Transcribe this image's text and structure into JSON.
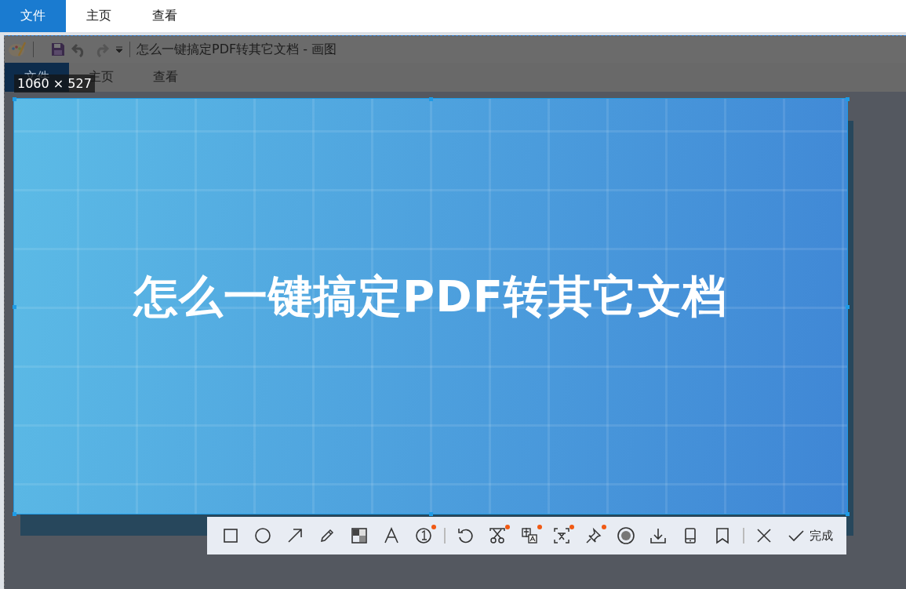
{
  "app_tabs": [
    {
      "label": "文件",
      "selected": true
    },
    {
      "label": "主页",
      "selected": false
    },
    {
      "label": "查看",
      "selected": false
    }
  ],
  "paint_window": {
    "title": "怎么一键搞定PDF转其它文档 - 画图",
    "ribbon_tabs": [
      {
        "label": "文件",
        "selected": true
      },
      {
        "label": "主页",
        "selected": false
      },
      {
        "label": "查看",
        "selected": false
      }
    ],
    "canvas_image": {
      "banner_title": "怎么一键搞定PDF转其它文档"
    }
  },
  "capture": {
    "size_label": "1060 × 527",
    "tool_groups": [
      [
        {
          "kind": "rectangle",
          "badge": false
        },
        {
          "kind": "ellipse",
          "badge": false
        },
        {
          "kind": "arrow",
          "badge": false
        },
        {
          "kind": "pencil",
          "badge": false
        },
        {
          "kind": "mosaic",
          "badge": false
        },
        {
          "kind": "text",
          "badge": false
        },
        {
          "kind": "number",
          "badge": true
        }
      ],
      [
        {
          "kind": "undo",
          "badge": false
        },
        {
          "kind": "scissors",
          "badge": true
        },
        {
          "kind": "translate",
          "badge": true
        },
        {
          "kind": "ocr",
          "badge": true
        },
        {
          "kind": "pin",
          "badge": true
        },
        {
          "kind": "record",
          "badge": false
        },
        {
          "kind": "download",
          "badge": false
        },
        {
          "kind": "phone",
          "badge": false
        },
        {
          "kind": "bookmark",
          "badge": false
        }
      ],
      [
        {
          "kind": "close",
          "badge": false
        },
        {
          "kind": "done",
          "badge": false,
          "label": "完成"
        }
      ]
    ]
  }
}
